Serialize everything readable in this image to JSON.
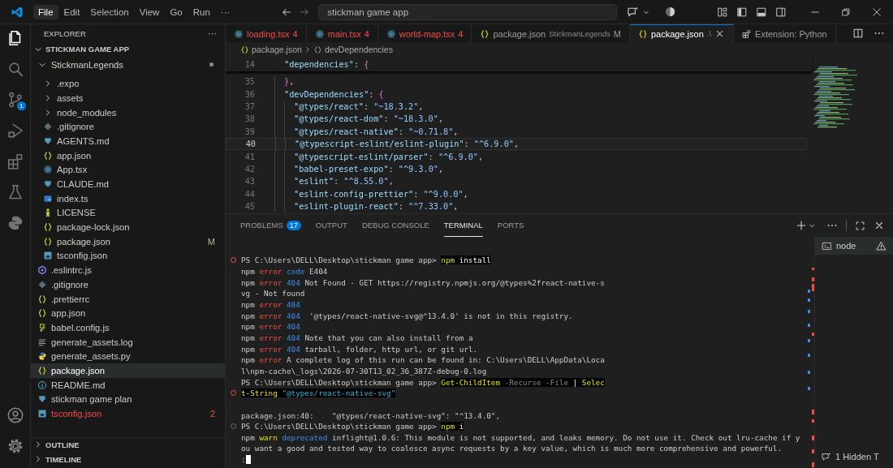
{
  "title_bar": {
    "menu": [
      {
        "label": "File",
        "selected": true
      },
      {
        "label": "Edit",
        "selected": false
      },
      {
        "label": "Selection",
        "selected": false
      },
      {
        "label": "View",
        "selected": false
      },
      {
        "label": "Go",
        "selected": false
      },
      {
        "label": "Run",
        "selected": false
      },
      {
        "label": "···",
        "selected": false
      }
    ],
    "search": {
      "value": "stickman game app"
    }
  },
  "activity_bar": {
    "items": [
      {
        "kind": "files",
        "selected": true
      },
      {
        "kind": "search",
        "selected": false
      },
      {
        "kind": "source-control",
        "selected": false,
        "badge": "1"
      },
      {
        "kind": "run-debug",
        "selected": false
      },
      {
        "kind": "extensions",
        "selected": false
      },
      {
        "kind": "testing",
        "selected": false
      },
      {
        "kind": "python",
        "selected": false
      }
    ],
    "bottom": [
      {
        "kind": "account"
      },
      {
        "kind": "settings"
      }
    ]
  },
  "sidebar": {
    "title": "EXPLORER",
    "more": "···",
    "root": {
      "label": "STICKMAN GAME APP",
      "expanded": true,
      "children": [
        {
          "label": "StickmanLegends",
          "kind": "folder",
          "expanded": true,
          "modified": true,
          "error": false,
          "selected": false,
          "children": [
            {
              "label": ".expo",
              "kind": "folder",
              "expanded": false,
              "modified": false,
              "error": false,
              "selected": false
            },
            {
              "label": "assets",
              "kind": "folder",
              "expanded": false,
              "modified": false,
              "error": false,
              "selected": false
            },
            {
              "label": "node_modules",
              "kind": "folder",
              "expanded": false,
              "modified": false,
              "error": false,
              "selected": false
            },
            {
              "label": ".gitignore",
              "kind": "git",
              "modified": false,
              "error": false,
              "selected": false
            },
            {
              "label": "AGENTS.md",
              "kind": "md",
              "modified": false,
              "error": false,
              "selected": false
            },
            {
              "label": "app.json",
              "kind": "json",
              "modified": false,
              "error": false,
              "selected": false
            },
            {
              "label": "App.tsx",
              "kind": "tsx",
              "modified": false,
              "error": false,
              "selected": false
            },
            {
              "label": "CLAUDE.md",
              "kind": "md",
              "modified": false,
              "error": false,
              "selected": false
            },
            {
              "label": "index.ts",
              "kind": "ts",
              "modified": false,
              "error": false,
              "selected": false
            },
            {
              "label": "LICENSE",
              "kind": "license",
              "modified": false,
              "error": false,
              "selected": false
            },
            {
              "label": "package-lock.json",
              "kind": "json",
              "modified": false,
              "error": false,
              "selected": false
            },
            {
              "label": "package.json",
              "kind": "json",
              "modified": true,
              "error": false,
              "badge": "M",
              "selected": false
            },
            {
              "label": "tsconfig.json",
              "kind": "tsconfig",
              "modified": false,
              "error": false,
              "selected": false
            }
          ]
        },
        {
          "label": ".eslintrc.js",
          "kind": "eslint",
          "modified": false,
          "error": false,
          "selected": false
        },
        {
          "label": ".gitignore",
          "kind": "git",
          "modified": false,
          "error": false,
          "selected": false
        },
        {
          "label": ".prettierrc",
          "kind": "json",
          "modified": false,
          "error": false,
          "selected": false
        },
        {
          "label": "app.json",
          "kind": "json",
          "modified": false,
          "error": false,
          "selected": false
        },
        {
          "label": "babel.config.js",
          "kind": "babel",
          "modified": false,
          "error": false,
          "selected": false
        },
        {
          "label": "generate_assets.log",
          "kind": "log",
          "modified": false,
          "error": false,
          "selected": false
        },
        {
          "label": "generate_assets.py",
          "kind": "py",
          "modified": false,
          "error": false,
          "selected": false
        },
        {
          "label": "package.json",
          "kind": "json",
          "modified": false,
          "error": false,
          "selected": true
        },
        {
          "label": "README.md",
          "kind": "info",
          "modified": false,
          "error": false,
          "selected": false
        },
        {
          "label": "stickman game plan",
          "kind": "md",
          "modified": false,
          "error": false,
          "selected": false
        },
        {
          "label": "tsconfig.json",
          "kind": "tsconfig",
          "modified": false,
          "error": true,
          "badge": "2",
          "selected": false
        }
      ]
    },
    "sections": [
      {
        "label": "OUTLINE",
        "expanded": false
      },
      {
        "label": "TIMELINE",
        "expanded": false
      }
    ]
  },
  "tabs": [
    {
      "label": "loading.tsx",
      "badge": "4",
      "kind": "tsx",
      "error": true,
      "selected": false
    },
    {
      "label": "main.tsx",
      "badge": "4",
      "kind": "tsx",
      "error": true,
      "selected": false
    },
    {
      "label": "world-map.tsx",
      "badge": "4",
      "kind": "tsx",
      "error": true,
      "selected": false
    },
    {
      "label": "package.json",
      "detail": "StickmanLegends",
      "badge": "M",
      "kind": "json",
      "error": false,
      "selected": false
    },
    {
      "label": "package.json",
      "detail": ".\\",
      "kind": "json",
      "error": false,
      "selected": true
    },
    {
      "label": "Extension: Python",
      "kind": "extension",
      "error": false,
      "selected": false
    }
  ],
  "breadcrumb": [
    {
      "kind": "json",
      "label": "package.json"
    },
    {
      "kind": "object",
      "label": "devDependencies"
    }
  ],
  "code": {
    "sticky": {
      "number": "14",
      "segments": [
        {
          "kind": "key",
          "text": "\"dependencies\""
        },
        {
          "kind": "punct",
          "text": ": "
        },
        {
          "kind": "brace",
          "text": "{"
        }
      ]
    },
    "lines": [
      {
        "number": "35",
        "current": false,
        "segments": [
          {
            "kind": "brace",
            "text": "}"
          },
          {
            "kind": "punct",
            "text": ","
          }
        ]
      },
      {
        "number": "36",
        "current": false,
        "segments": [
          {
            "kind": "key",
            "text": "\"devDependencies\""
          },
          {
            "kind": "punct",
            "text": ": "
          },
          {
            "kind": "brace",
            "text": "{"
          }
        ],
        "children": [
          {
            "number": "37",
            "current": false,
            "segments": [
              {
                "kind": "key",
                "text": "\"@types/react\""
              },
              {
                "kind": "punct",
                "text": ": "
              },
              {
                "kind": "value",
                "text": "\"~18.3.2\""
              },
              {
                "kind": "punct",
                "text": ","
              }
            ]
          },
          {
            "number": "38",
            "current": false,
            "segments": [
              {
                "kind": "key",
                "text": "\"@types/react-dom\""
              },
              {
                "kind": "punct",
                "text": ": "
              },
              {
                "kind": "value",
                "text": "\"~18.3.0\""
              },
              {
                "kind": "punct",
                "text": ","
              }
            ]
          },
          {
            "number": "39",
            "current": false,
            "segments": [
              {
                "kind": "key",
                "text": "\"@types/react-native\""
              },
              {
                "kind": "punct",
                "text": ": "
              },
              {
                "kind": "value",
                "text": "\"~0.71.8\""
              },
              {
                "kind": "punct",
                "text": ","
              }
            ]
          },
          {
            "number": "40",
            "current": true,
            "segments": [
              {
                "kind": "key",
                "text": "\"@typescript-eslint/eslint-plugin\""
              },
              {
                "kind": "punct",
                "text": ": "
              },
              {
                "kind": "value",
                "text": "\"^6.9.0\""
              },
              {
                "kind": "punct",
                "text": ","
              }
            ]
          },
          {
            "number": "41",
            "current": false,
            "segments": [
              {
                "kind": "key",
                "text": "\"@typescript-eslint/parser\""
              },
              {
                "kind": "punct",
                "text": ": "
              },
              {
                "kind": "value",
                "text": "\"^6.9.0\""
              },
              {
                "kind": "punct",
                "text": ","
              }
            ]
          },
          {
            "number": "42",
            "current": false,
            "segments": [
              {
                "kind": "key",
                "text": "\"babel-preset-expo\""
              },
              {
                "kind": "punct",
                "text": ": "
              },
              {
                "kind": "value",
                "text": "\"^9.3.0\""
              },
              {
                "kind": "punct",
                "text": ","
              }
            ]
          },
          {
            "number": "43",
            "current": false,
            "segments": [
              {
                "kind": "key",
                "text": "\"eslint\""
              },
              {
                "kind": "punct",
                "text": ": "
              },
              {
                "kind": "value",
                "text": "\"^8.55.0\""
              },
              {
                "kind": "punct",
                "text": ","
              }
            ]
          },
          {
            "number": "44",
            "current": false,
            "segments": [
              {
                "kind": "key",
                "text": "\"eslint-config-prettier\""
              },
              {
                "kind": "punct",
                "text": ": "
              },
              {
                "kind": "value",
                "text": "\"^9.0.0\""
              },
              {
                "kind": "punct",
                "text": ","
              }
            ]
          },
          {
            "number": "45",
            "current": false,
            "segments": [
              {
                "kind": "key",
                "text": "\"eslint-plugin-react\""
              },
              {
                "kind": "punct",
                "text": ": "
              },
              {
                "kind": "value",
                "text": "\"^7.33.0\""
              },
              {
                "kind": "punct",
                "text": ","
              }
            ]
          }
        ]
      }
    ]
  },
  "panel": {
    "tabs": [
      {
        "label": "PROBLEMS",
        "count": "17",
        "selected": false
      },
      {
        "label": "OUTPUT",
        "selected": false
      },
      {
        "label": "DEBUG CONSOLE",
        "selected": false
      },
      {
        "label": "TERMINAL",
        "selected": true
      },
      {
        "label": "PORTS",
        "selected": false
      }
    ],
    "terminal": [
      {
        "command": true,
        "failed": true,
        "segments": [
          {
            "kind": "plain",
            "text": "PS C:\\Users\\DELL\\Desktop\\stickman game app> "
          },
          {
            "kind": "cmd",
            "text": "npm"
          },
          {
            "kind": "arg",
            "text": " install"
          }
        ]
      },
      {
        "command": false,
        "segments": [
          {
            "kind": "plain",
            "text": "npm "
          },
          {
            "kind": "err",
            "text": "error"
          },
          {
            "kind": "num",
            "text": " code"
          },
          {
            "kind": "plain",
            "text": " E404"
          }
        ]
      },
      {
        "command": false,
        "segments": [
          {
            "kind": "plain",
            "text": "npm "
          },
          {
            "kind": "err",
            "text": "error"
          },
          {
            "kind": "num",
            "text": " 404"
          },
          {
            "kind": "plain",
            "text": " Not Found - GET https://registry.npmjs.org/@types%2freact-native-s"
          }
        ]
      },
      {
        "command": false,
        "segments": [
          {
            "kind": "plain",
            "text": "vg - Not found"
          }
        ]
      },
      {
        "command": false,
        "segments": [
          {
            "kind": "plain",
            "text": "npm "
          },
          {
            "kind": "err",
            "text": "error"
          },
          {
            "kind": "num",
            "text": " 404"
          }
        ]
      },
      {
        "command": false,
        "segments": [
          {
            "kind": "plain",
            "text": "npm "
          },
          {
            "kind": "err",
            "text": "error"
          },
          {
            "kind": "num",
            "text": " 404"
          },
          {
            "kind": "plain",
            "text": "  '@types/react-native-svg@^13.4.0' is not in this registry."
          }
        ]
      },
      {
        "command": false,
        "segments": [
          {
            "kind": "plain",
            "text": "npm "
          },
          {
            "kind": "err",
            "text": "error"
          },
          {
            "kind": "num",
            "text": " 404"
          }
        ]
      },
      {
        "command": false,
        "segments": [
          {
            "kind": "plain",
            "text": "npm "
          },
          {
            "kind": "err",
            "text": "error"
          },
          {
            "kind": "num",
            "text": " 404"
          },
          {
            "kind": "plain",
            "text": " Note that you can also install from a"
          }
        ]
      },
      {
        "command": false,
        "segments": [
          {
            "kind": "plain",
            "text": "npm "
          },
          {
            "kind": "err",
            "text": "error"
          },
          {
            "kind": "num",
            "text": " 404"
          },
          {
            "kind": "plain",
            "text": " tarball, folder, http url, or git url."
          }
        ]
      },
      {
        "command": false,
        "segments": [
          {
            "kind": "plain",
            "text": "npm "
          },
          {
            "kind": "err",
            "text": "error"
          },
          {
            "kind": "plain",
            "text": " A complete log of this run can be found in: C:\\Users\\DELL\\AppData\\Loca"
          }
        ]
      },
      {
        "command": false,
        "segments": [
          {
            "kind": "plain",
            "text": "l\\npm-cache\\_logs\\2026-07-30T13_02_36_387Z-debug-0.log"
          }
        ]
      },
      {
        "command": false,
        "segments": [
          {
            "kind": "plain",
            "text": "PS C:\\Users\\DELL\\Desktop\\stickman game app> "
          },
          {
            "kind": "cmd",
            "text": "Get-ChildItem"
          },
          {
            "kind": "param",
            "text": " -Recurse -File"
          },
          {
            "kind": "arg",
            "text": " | "
          },
          {
            "kind": "cmd",
            "text": "Selec"
          }
        ]
      },
      {
        "command": true,
        "failed": true,
        "segments": [
          {
            "kind": "cmd",
            "text": "t-String"
          },
          {
            "kind": "str",
            "text": " \"@types/react-native-svg\""
          }
        ]
      },
      {
        "command": false
      },
      {
        "command": false,
        "segments": [
          {
            "kind": "plain",
            "text": "package.json:40:    \"@types/react-native-svg\": \"^13.4.0\","
          }
        ]
      },
      {
        "command": true,
        "failed": false,
        "segments": [
          {
            "kind": "plain",
            "text": "PS C:\\Users\\DELL\\Desktop\\stickman game app> "
          },
          {
            "kind": "cmd",
            "text": "npm"
          },
          {
            "kind": "arg",
            "text": " i"
          }
        ]
      },
      {
        "command": false,
        "segments": [
          {
            "kind": "plain",
            "text": "npm "
          },
          {
            "kind": "warn",
            "text": "warn"
          },
          {
            "kind": "num",
            "text": " deprecated"
          },
          {
            "kind": "plain",
            "text": " inflight@1.0.6: This module is not supported, and leaks memory. Do not use it. Check out lru-cache if y"
          }
        ]
      },
      {
        "command": false,
        "segments": [
          {
            "kind": "plain",
            "text": "ou want a good and tested way to coalesce async requests by a key value, which is much more comprehensive and powerful."
          }
        ]
      },
      {
        "command": false,
        "segments": [
          {
            "kind": "plain",
            "text": ":"
          }
        ],
        "cursor": true
      }
    ],
    "terminals": [
      {
        "label": "node",
        "warning": true
      }
    ],
    "hidden": "1 Hidden T"
  }
}
